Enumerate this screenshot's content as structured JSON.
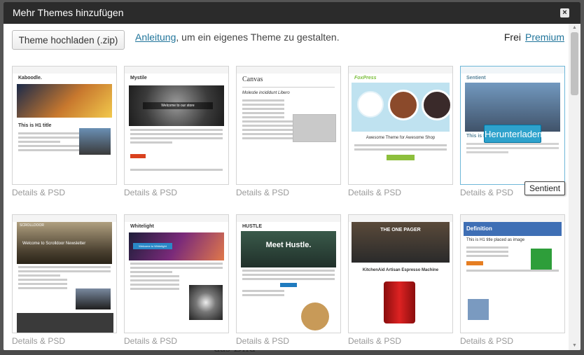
{
  "dialog": {
    "title": "Mehr Themes hinzufügen",
    "close_label": "×"
  },
  "toolbar": {
    "upload_label": "Theme hochladen (.zip)",
    "guide_link": "Anleitung",
    "guide_rest": ", um ein eigenes Theme zu gestalten.",
    "filter_free": "Frei",
    "filter_premium": "Premium"
  },
  "themes": [
    {
      "name": "Kaboodle",
      "details": "Details & PSD",
      "logo": "Kaboodle.",
      "heading": "This is H1 title",
      "accent": "#c0392b"
    },
    {
      "name": "Mystile",
      "details": "Details & PSD",
      "logo": "Mystile",
      "heading": "Welcome to our store",
      "accent": "#d9411e"
    },
    {
      "name": "Canvas",
      "details": "Details & PSD",
      "logo": "Canvas",
      "heading": "Molestie incididunt Libero",
      "accent": "#2a6496"
    },
    {
      "name": "FoxPress",
      "details": "Details & PSD",
      "logo": "FoxPress",
      "heading": "Awesome Theme for Awesome Shop",
      "accent": "#8dbf3c"
    },
    {
      "name": "Sentient",
      "details": "Details & PSD",
      "logo": "Sentient",
      "heading": "This is H1 title",
      "accent": "#2ea2cc"
    },
    {
      "name": "Scrolldoor",
      "details": "Details & PSD",
      "logo": "SCROLLDOOR",
      "heading": "Welcome to Scrolldoor Newsletter",
      "accent": "#333333"
    },
    {
      "name": "Whitelight",
      "details": "Details & PSD",
      "logo": "Whitelight",
      "heading": "Welcome to Whitelight",
      "accent": "#2a88c7"
    },
    {
      "name": "Hustle",
      "details": "Details & PSD",
      "logo": "HUSTLE",
      "heading": "Meet Hustle.",
      "accent": "#1f7bbf"
    },
    {
      "name": "The One Pager",
      "details": "Details & PSD",
      "logo": "THE ONE PAGER",
      "heading": "KitchenAid Artisan Espresso Machine",
      "accent": "#c0392b"
    },
    {
      "name": "Definition",
      "details": "Details & PSD",
      "logo": "Definition",
      "heading": "This is H1 title placed as image",
      "accent": "#3f6fb5"
    }
  ],
  "hover": {
    "download_label": "Herunterladen",
    "tooltip": "Sentient"
  },
  "backdrop": {
    "visible_text": "das Bild"
  },
  "colors": {
    "titlebar": "#2b2b2b",
    "link": "#21759b",
    "download_button": "#2ea2cc"
  }
}
